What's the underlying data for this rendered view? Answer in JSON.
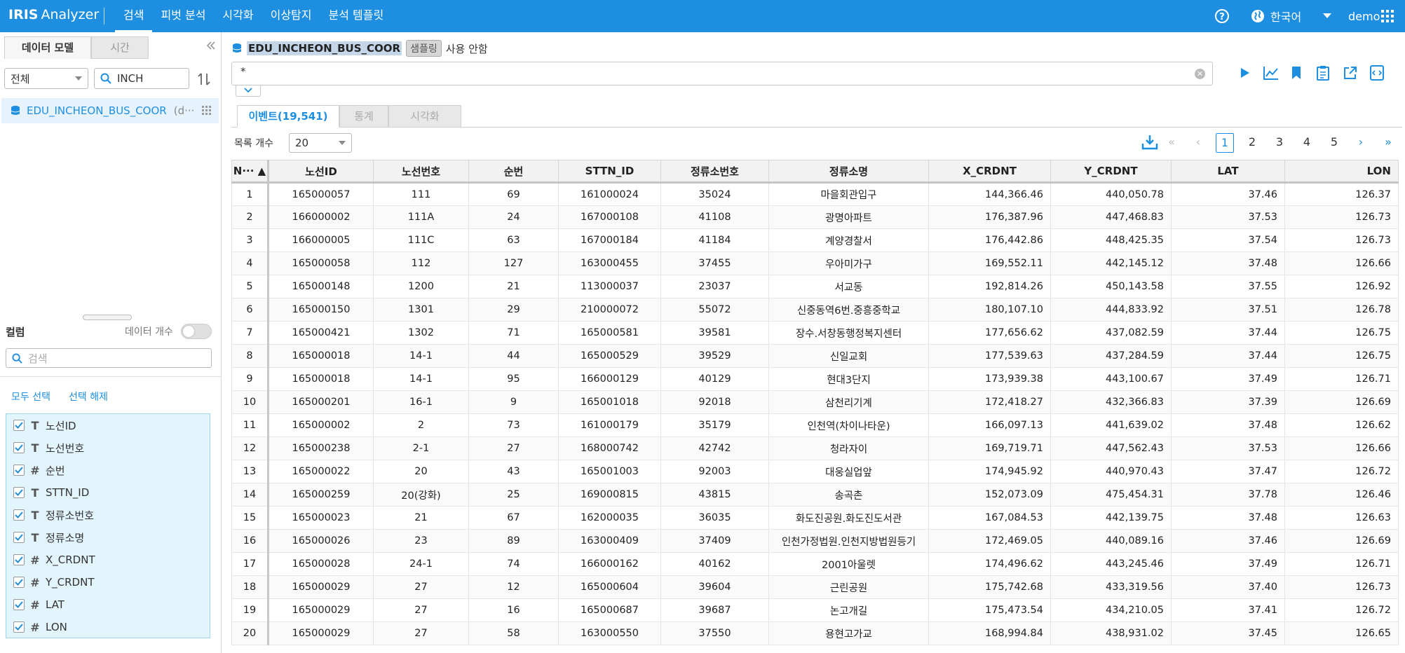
{
  "app": {
    "brand": "IRIS",
    "name": "Analyzer"
  },
  "nav": [
    {
      "label": "검색",
      "active": true
    },
    {
      "label": "피벗 분석"
    },
    {
      "label": "시각화"
    },
    {
      "label": "이상탐지"
    },
    {
      "label": "분석 템플릿"
    }
  ],
  "topbar": {
    "language": "한국어",
    "user": "demo"
  },
  "left_panel": {
    "tabs": [
      "데이터 모델",
      "시간"
    ],
    "scope_select": "전체",
    "search_value": "INCH",
    "model_item": {
      "name": "EDU_INCHEON_BUS_COOR",
      "suffix": "(d···"
    },
    "columns_title": "컬럼",
    "data_count_label": "데이터 개수",
    "column_search_placeholder": "검색",
    "select_all": "모두 선택",
    "deselect": "선택 해제",
    "columns": [
      {
        "type": "T",
        "name": "노선ID"
      },
      {
        "type": "T",
        "name": "노선번호"
      },
      {
        "type": "#",
        "name": "순번"
      },
      {
        "type": "T",
        "name": "STTN_ID"
      },
      {
        "type": "T",
        "name": "정류소번호"
      },
      {
        "type": "T",
        "name": "정류소명"
      },
      {
        "type": "#",
        "name": "X_CRDNT"
      },
      {
        "type": "#",
        "name": "Y_CRDNT"
      },
      {
        "type": "#",
        "name": "LAT"
      },
      {
        "type": "#",
        "name": "LON"
      }
    ]
  },
  "query": {
    "dataset": "EDU_INCHEON_BUS_COOR",
    "sampling_badge": "샘플링",
    "sampling_status": "사용 안함",
    "text": "*"
  },
  "result_tabs": [
    "이벤트(19,541)",
    "통계",
    "시각화"
  ],
  "list_count_label": "목록 개수",
  "list_count_value": "20",
  "pagination": {
    "pages": [
      "1",
      "2",
      "3",
      "4",
      "5"
    ],
    "current": "1"
  },
  "table": {
    "headers": [
      "N··· ▲",
      "노선ID",
      "노선번호",
      "순번",
      "STTN_ID",
      "정류소번호",
      "정류소명",
      "X_CRDNT",
      "Y_CRDNT",
      "LAT",
      "LON"
    ],
    "rows": [
      [
        "1",
        "165000057",
        "111",
        "69",
        "161000024",
        "35024",
        "마을회관입구",
        "144,366.46",
        "440,050.78",
        "37.46",
        "126.37"
      ],
      [
        "2",
        "166000002",
        "111A",
        "24",
        "167000108",
        "41108",
        "광명아파트",
        "176,387.96",
        "447,468.83",
        "37.53",
        "126.73"
      ],
      [
        "3",
        "166000005",
        "111C",
        "63",
        "167000184",
        "41184",
        "계양경찰서",
        "176,442.86",
        "448,425.35",
        "37.54",
        "126.73"
      ],
      [
        "4",
        "165000058",
        "112",
        "127",
        "163000455",
        "37455",
        "우아미가구",
        "169,552.11",
        "442,145.12",
        "37.48",
        "126.66"
      ],
      [
        "5",
        "165000148",
        "1200",
        "21",
        "113000037",
        "23037",
        "서교동",
        "192,814.26",
        "450,143.58",
        "37.55",
        "126.92"
      ],
      [
        "6",
        "165000150",
        "1301",
        "29",
        "210000072",
        "55072",
        "신중동역6번.중흥중학교",
        "180,107.10",
        "444,833.92",
        "37.51",
        "126.78"
      ],
      [
        "7",
        "165000421",
        "1302",
        "71",
        "165000581",
        "39581",
        "장수.서창동행정복지센터",
        "177,656.62",
        "437,082.59",
        "37.44",
        "126.75"
      ],
      [
        "8",
        "165000018",
        "14-1",
        "44",
        "165000529",
        "39529",
        "신일교회",
        "177,539.63",
        "437,284.59",
        "37.44",
        "126.75"
      ],
      [
        "9",
        "165000018",
        "14-1",
        "95",
        "166000129",
        "40129",
        "현대3단지",
        "173,939.38",
        "443,100.67",
        "37.49",
        "126.71"
      ],
      [
        "10",
        "165000201",
        "16-1",
        "9",
        "165001018",
        "92018",
        "삼천리기계",
        "172,418.27",
        "432,366.83",
        "37.39",
        "126.69"
      ],
      [
        "11",
        "165000002",
        "2",
        "73",
        "161000179",
        "35179",
        "인천역(차이나타운)",
        "166,097.13",
        "441,639.02",
        "37.48",
        "126.62"
      ],
      [
        "12",
        "165000238",
        "2-1",
        "27",
        "168000742",
        "42742",
        "청라자이",
        "169,719.71",
        "447,562.43",
        "37.53",
        "126.66"
      ],
      [
        "13",
        "165000022",
        "20",
        "43",
        "165001003",
        "92003",
        "대웅실업앞",
        "174,945.92",
        "440,970.43",
        "37.47",
        "126.72"
      ],
      [
        "14",
        "165000259",
        "20(강화)",
        "25",
        "169000815",
        "43815",
        "송곡촌",
        "152,073.09",
        "475,454.31",
        "37.78",
        "126.46"
      ],
      [
        "15",
        "165000023",
        "21",
        "67",
        "162000035",
        "36035",
        "화도진공원.화도진도서관",
        "167,084.53",
        "442,139.75",
        "37.48",
        "126.63"
      ],
      [
        "16",
        "165000026",
        "23",
        "89",
        "163000409",
        "37409",
        "인천가정법원.인천지방법원등기",
        "172,469.05",
        "440,089.16",
        "37.46",
        "126.69"
      ],
      [
        "17",
        "165000028",
        "24-1",
        "74",
        "166000162",
        "40162",
        "2001아울렛",
        "174,496.62",
        "443,245.46",
        "37.49",
        "126.71"
      ],
      [
        "18",
        "165000029",
        "27",
        "12",
        "165000604",
        "39604",
        "근린공원",
        "175,742.68",
        "433,319.56",
        "37.40",
        "126.73"
      ],
      [
        "19",
        "165000029",
        "27",
        "16",
        "165000687",
        "39687",
        "논고개길",
        "175,473.54",
        "434,210.05",
        "37.41",
        "126.72"
      ],
      [
        "20",
        "165000029",
        "27",
        "58",
        "163000550",
        "37550",
        "용현고가교",
        "168,994.84",
        "438,931.02",
        "37.45",
        "126.65"
      ]
    ]
  }
}
